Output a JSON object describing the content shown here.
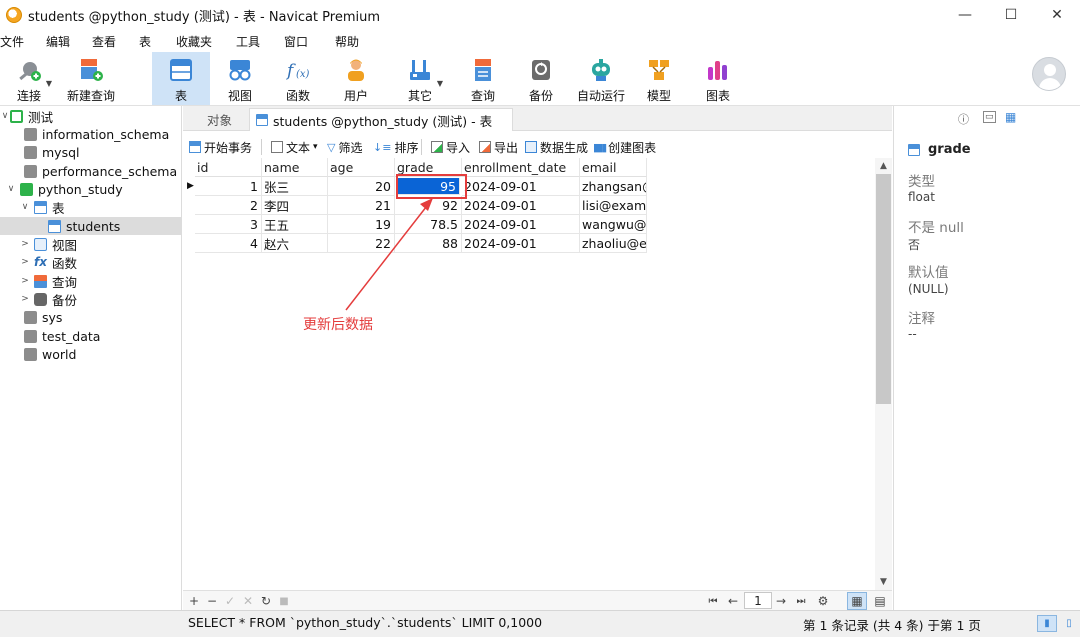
{
  "window": {
    "title": "students @python_study (测试) - 表 - Navicat Premium",
    "controls": {
      "minimize": "—",
      "maximize": "☐",
      "close": "✕"
    }
  },
  "menu": [
    "文件",
    "编辑",
    "查看",
    "表",
    "收藏夹",
    "工具",
    "窗口",
    "帮助"
  ],
  "toolbar": {
    "items": [
      {
        "label": "连接",
        "icon": "connection-plug-icon"
      },
      {
        "label": "新建查询",
        "icon": "new-query-icon"
      },
      {
        "label": "表",
        "icon": "table-icon"
      },
      {
        "label": "视图",
        "icon": "view-glasses-icon"
      },
      {
        "label": "函数",
        "icon": "function-fx-icon"
      },
      {
        "label": "用户",
        "icon": "user-icon"
      },
      {
        "label": "其它",
        "icon": "tools-icon"
      },
      {
        "label": "查询",
        "icon": "query-icon"
      },
      {
        "label": "备份",
        "icon": "backup-icon"
      },
      {
        "label": "自动运行",
        "icon": "robot-icon"
      },
      {
        "label": "模型",
        "icon": "model-icon"
      },
      {
        "label": "图表",
        "icon": "chart-icon"
      }
    ],
    "active": "表"
  },
  "sidebar": {
    "connection": "测试",
    "databases": [
      "information_schema",
      "mysql",
      "performance_schema"
    ],
    "current_db": "python_study",
    "tables_folder": "表",
    "current_table": "students",
    "folders": [
      "视图",
      "函数",
      "查询",
      "备份"
    ],
    "other_dbs": [
      "sys",
      "test_data",
      "world"
    ],
    "chevron_open": "∨",
    "chevron_closed": ">",
    "fx": "fx"
  },
  "tabs": {
    "objects": "对象",
    "active": "students @python_study (测试) - 表"
  },
  "subtoolbar": {
    "begin_transaction": "开始事务",
    "text": "文本",
    "filter": "筛选",
    "sort": "排序",
    "import": "导入",
    "export": "导出",
    "data_gen": "数据生成",
    "create_chart": "创建图表",
    "dropdown": "▾"
  },
  "grid": {
    "columns": [
      "id",
      "name",
      "age",
      "grade",
      "enrollment_date",
      "email"
    ],
    "rows": [
      [
        "1",
        "张三",
        "20",
        "95",
        "2024-09-01",
        "zhangsan@e"
      ],
      [
        "2",
        "李四",
        "21",
        "92",
        "2024-09-01",
        "lisi@examp"
      ],
      [
        "3",
        "王五",
        "19",
        "78.5",
        "2024-09-01",
        "wangwu@e"
      ],
      [
        "4",
        "赵六",
        "22",
        "88",
        "2024-09-01",
        "zhaoliu@ex"
      ]
    ],
    "current_row_marker": "▶",
    "selected_cell": {
      "row": 0,
      "col": 3
    }
  },
  "annotation": {
    "text": "更新后数据",
    "color": "#e43c3c"
  },
  "right_panel": {
    "field": "grade",
    "type_label": "类型",
    "type_value": "float",
    "notnull_label": "不是 null",
    "notnull_value": "否",
    "default_label": "默认值",
    "default_value": "(NULL)",
    "comment_label": "注释",
    "comment_value": "--"
  },
  "gridbar": {
    "add": "+",
    "remove": "−",
    "apply": "✓",
    "cancel": "✕",
    "refresh": "↻",
    "stop": "■",
    "first": "⏮",
    "prev": "←",
    "page": "1",
    "next": "→",
    "last": "⏭",
    "settings": "⚙"
  },
  "status": {
    "sql": "SELECT * FROM `python_study`.`students` LIMIT 0,1000",
    "info": "第 1 条记录 (共 4 条) 于第 1 页"
  },
  "colors": {
    "accent": "#0a64d6",
    "toolbar_active": "#cfe3f7",
    "annotation": "#e43c3c"
  }
}
